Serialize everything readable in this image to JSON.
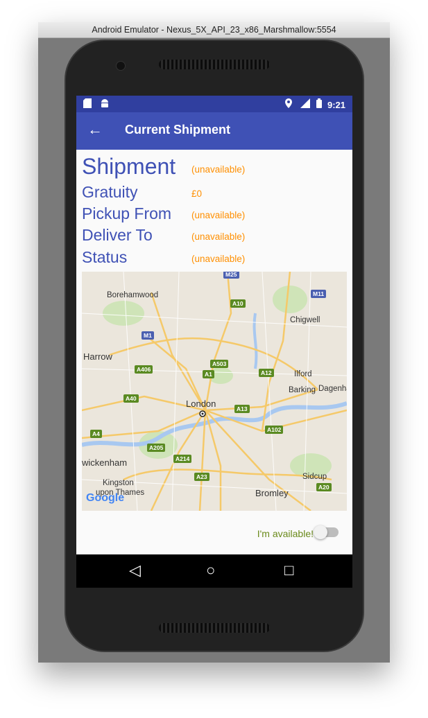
{
  "window": {
    "title": "Android Emulator - Nexus_5X_API_23_x86_Marshmallow:5554"
  },
  "statusbar": {
    "left_icons": [
      "sd-card-icon",
      "android-icon"
    ],
    "time": "9:21",
    "right_icons": [
      "location-icon",
      "lte-signal-icon",
      "battery-icon"
    ]
  },
  "appbar": {
    "back_icon": "←",
    "title": "Current Shipment"
  },
  "details": {
    "shipment_label": "Shipment",
    "shipment_value": "(unavailable)",
    "gratuity_label": "Gratuity",
    "gratuity_value": "£0",
    "pickup_label": "Pickup From",
    "pickup_value": "(unavailable)",
    "deliver_label": "Deliver To",
    "deliver_value": "(unavailable)",
    "status_label": "Status",
    "status_value": "(unavailable)"
  },
  "map": {
    "places": {
      "borehamwood": "Borehamwood",
      "chigwell": "Chigwell",
      "harrow": "Harrow",
      "ilford": "Ilford",
      "barking": "Barking",
      "dagenham": "Dagenha",
      "london": "London",
      "twickenham": "wickenham",
      "kingston1": "Kingston",
      "kingston2": "upon Thames",
      "sidcup": "Sidcup",
      "bromley": "Bromley"
    },
    "roads": {
      "m25": "M25",
      "a10": "A10",
      "m11": "M11",
      "m1": "M1",
      "a503": "A503",
      "a406": "A406",
      "a1": "A1",
      "a12": "A12",
      "a40": "A40",
      "a13": "A13",
      "a4": "A4",
      "a102": "A102",
      "a205": "A205",
      "a214": "A214",
      "a23": "A23",
      "a20": "A20"
    },
    "attribution": "Google"
  },
  "availability": {
    "label": "I'm available!",
    "enabled": false
  },
  "navbar": {
    "back": "◁",
    "home": "○",
    "recents": "□"
  },
  "colors": {
    "primary": "#3f51b5",
    "primary_dark": "#303f9f",
    "accent": "#ff8f00",
    "available_text": "#6a8a1a"
  }
}
